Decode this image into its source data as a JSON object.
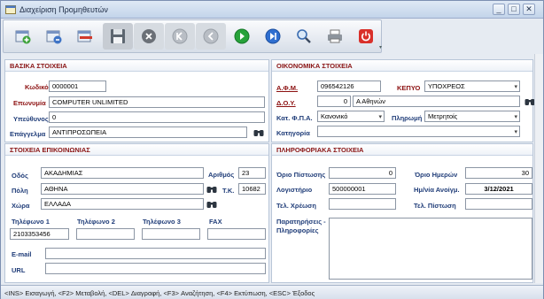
{
  "window": {
    "title": "Διαχείριση Προμηθευτών"
  },
  "window_buttons": {
    "minimize": "_",
    "maximize": "□",
    "close": "✕"
  },
  "toolbar": {
    "buttons": [
      {
        "name": "add-button",
        "icon": "add-icon"
      },
      {
        "name": "edit-button",
        "icon": "edit-icon"
      },
      {
        "name": "delete-button",
        "icon": "delete-icon"
      },
      {
        "name": "save-button",
        "icon": "floppy-icon"
      },
      {
        "name": "cancel-button",
        "icon": "cancel-icon"
      },
      {
        "name": "first-button",
        "icon": "first-icon"
      },
      {
        "name": "previous-button",
        "icon": "previous-icon"
      },
      {
        "name": "next-button",
        "icon": "next-icon"
      },
      {
        "name": "last-button",
        "icon": "last-icon"
      },
      {
        "name": "search-button",
        "icon": "search-icon"
      },
      {
        "name": "print-button",
        "icon": "printer-icon"
      },
      {
        "name": "exit-button",
        "icon": "power-icon"
      }
    ]
  },
  "basic": {
    "header": "ΒΑΣΙΚΑ ΣΤΟΙΧΕΙΑ",
    "code_label": "Κωδικός",
    "code_value": "0000001",
    "name_label": "Επωνυμία",
    "name_value": "COMPUTER UNLIMITED",
    "responsible_label": "Υπεύθυνος",
    "responsible_value": "0",
    "profession_label": "Επάγγελμα",
    "profession_value": "ΑΝΤΙΠΡΟΣΩΠΕΙΑ"
  },
  "contact": {
    "header": "ΣΤΟΙΧΕΙΑ ΕΠΙΚΟΙΝΩΝΙΑΣ",
    "street_label": "Οδός",
    "street_value": "ΑΚΑΔΗΜΙΑΣ",
    "number_label": "Αριθμός",
    "number_value": "23",
    "city_label": "Πόλη",
    "city_value": "ΑΘΗΝΑ",
    "zip_label": "Τ.Κ.",
    "zip_value": "10682",
    "country_label": "Χώρα",
    "country_value": "ΕΛΛΑΔΑ",
    "phone1_label": "Τηλέφωνο 1",
    "phone1_value": "2103353456",
    "phone2_label": "Τηλέφωνο 2",
    "phone2_value": "",
    "phone3_label": "Τηλέφωνο 3",
    "phone3_value": "",
    "fax_label": "FAX",
    "fax_value": "",
    "email_label": "E-mail",
    "email_value": "",
    "url_label": "URL",
    "url_value": ""
  },
  "financial": {
    "header": "ΟΙΚΟΝΟΜΙΚΑ ΣΤΟΙΧΕΙΑ",
    "afm_label": "Α.Φ.Μ.",
    "afm_value": "096542126",
    "kepyo_label": "ΚΕΠΥΟ",
    "kepyo_value": "ΥΠΟΧΡΕΟΣ",
    "doy_label": "Δ.Ο.Υ.",
    "doy_code": "0",
    "doy_value": "Α Αθηνών",
    "vat_label": "Κατ. Φ.Π.Α.",
    "vat_value": "Κανονικό",
    "payment_label": "Πληρωμή",
    "payment_value": "Μετρητοίς",
    "category_label": "Κατηγορία",
    "category_value": ""
  },
  "info": {
    "header": "ΠΛΗΡΟΦΟΡΙΑΚΑ ΣΤΟΙΧΕΙΑ",
    "credit_limit_label": "Όριο Πίστωσης",
    "credit_limit_value": "0",
    "days_limit_label": "Όριο Ημερών",
    "days_limit_value": "30",
    "account_label": "Λογιστήριο",
    "account_value": "500000001",
    "open_date_label": "Ημ/νία Ανοίγμ.",
    "open_date_value": "3/12/2021",
    "last_debit_label": "Τελ. Χρέωση",
    "last_debit_value": "",
    "last_credit_label": "Τελ. Πίστωση",
    "last_credit_value": "",
    "remarks_label_1": "Παρατηρήσεις -",
    "remarks_label_2": "Πληροφορίες",
    "remarks_value": ""
  },
  "statusbar": {
    "text": "<INS> Εισαγωγή, <F2> Μεταβολή, <DEL> Διαγραφή, <F3> Αναζήτηση, <F4> Εκτύπωση, <ESC> Έξοδος"
  }
}
